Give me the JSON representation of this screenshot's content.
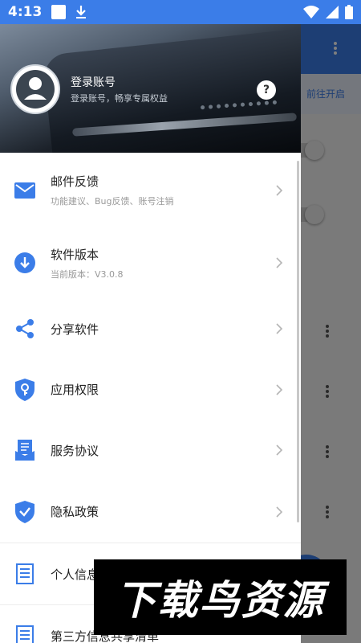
{
  "status_bar": {
    "time": "4:13"
  },
  "background_app": {
    "banner_link": "前往开启"
  },
  "drawer": {
    "header": {
      "login_title": "登录账号",
      "login_subtitle": "登录账号，畅享专属权益",
      "help_label": "?"
    },
    "items": [
      {
        "icon": "mail-icon",
        "title": "邮件反馈",
        "subtitle": "功能建议、Bug反馈、账号注销"
      },
      {
        "icon": "download-circle-icon",
        "title": "软件版本",
        "subtitle": "当前版本：V3.0.8"
      },
      {
        "icon": "share-icon",
        "title": "分享软件",
        "subtitle": ""
      },
      {
        "icon": "shield-key-icon",
        "title": "应用权限",
        "subtitle": ""
      },
      {
        "icon": "agreement-icon",
        "title": "服务协议",
        "subtitle": ""
      },
      {
        "icon": "shield-check-icon",
        "title": "隐私政策",
        "subtitle": ""
      },
      {
        "icon": "document-icon",
        "title": "个人信息",
        "subtitle": ""
      },
      {
        "icon": "document-icon",
        "title": "第三方信息共享清单",
        "subtitle": ""
      }
    ]
  },
  "watermark": {
    "text": "下载鸟资源"
  },
  "colors": {
    "accent": "#3b7de8",
    "text_primary": "#222222",
    "text_secondary": "#999999"
  }
}
